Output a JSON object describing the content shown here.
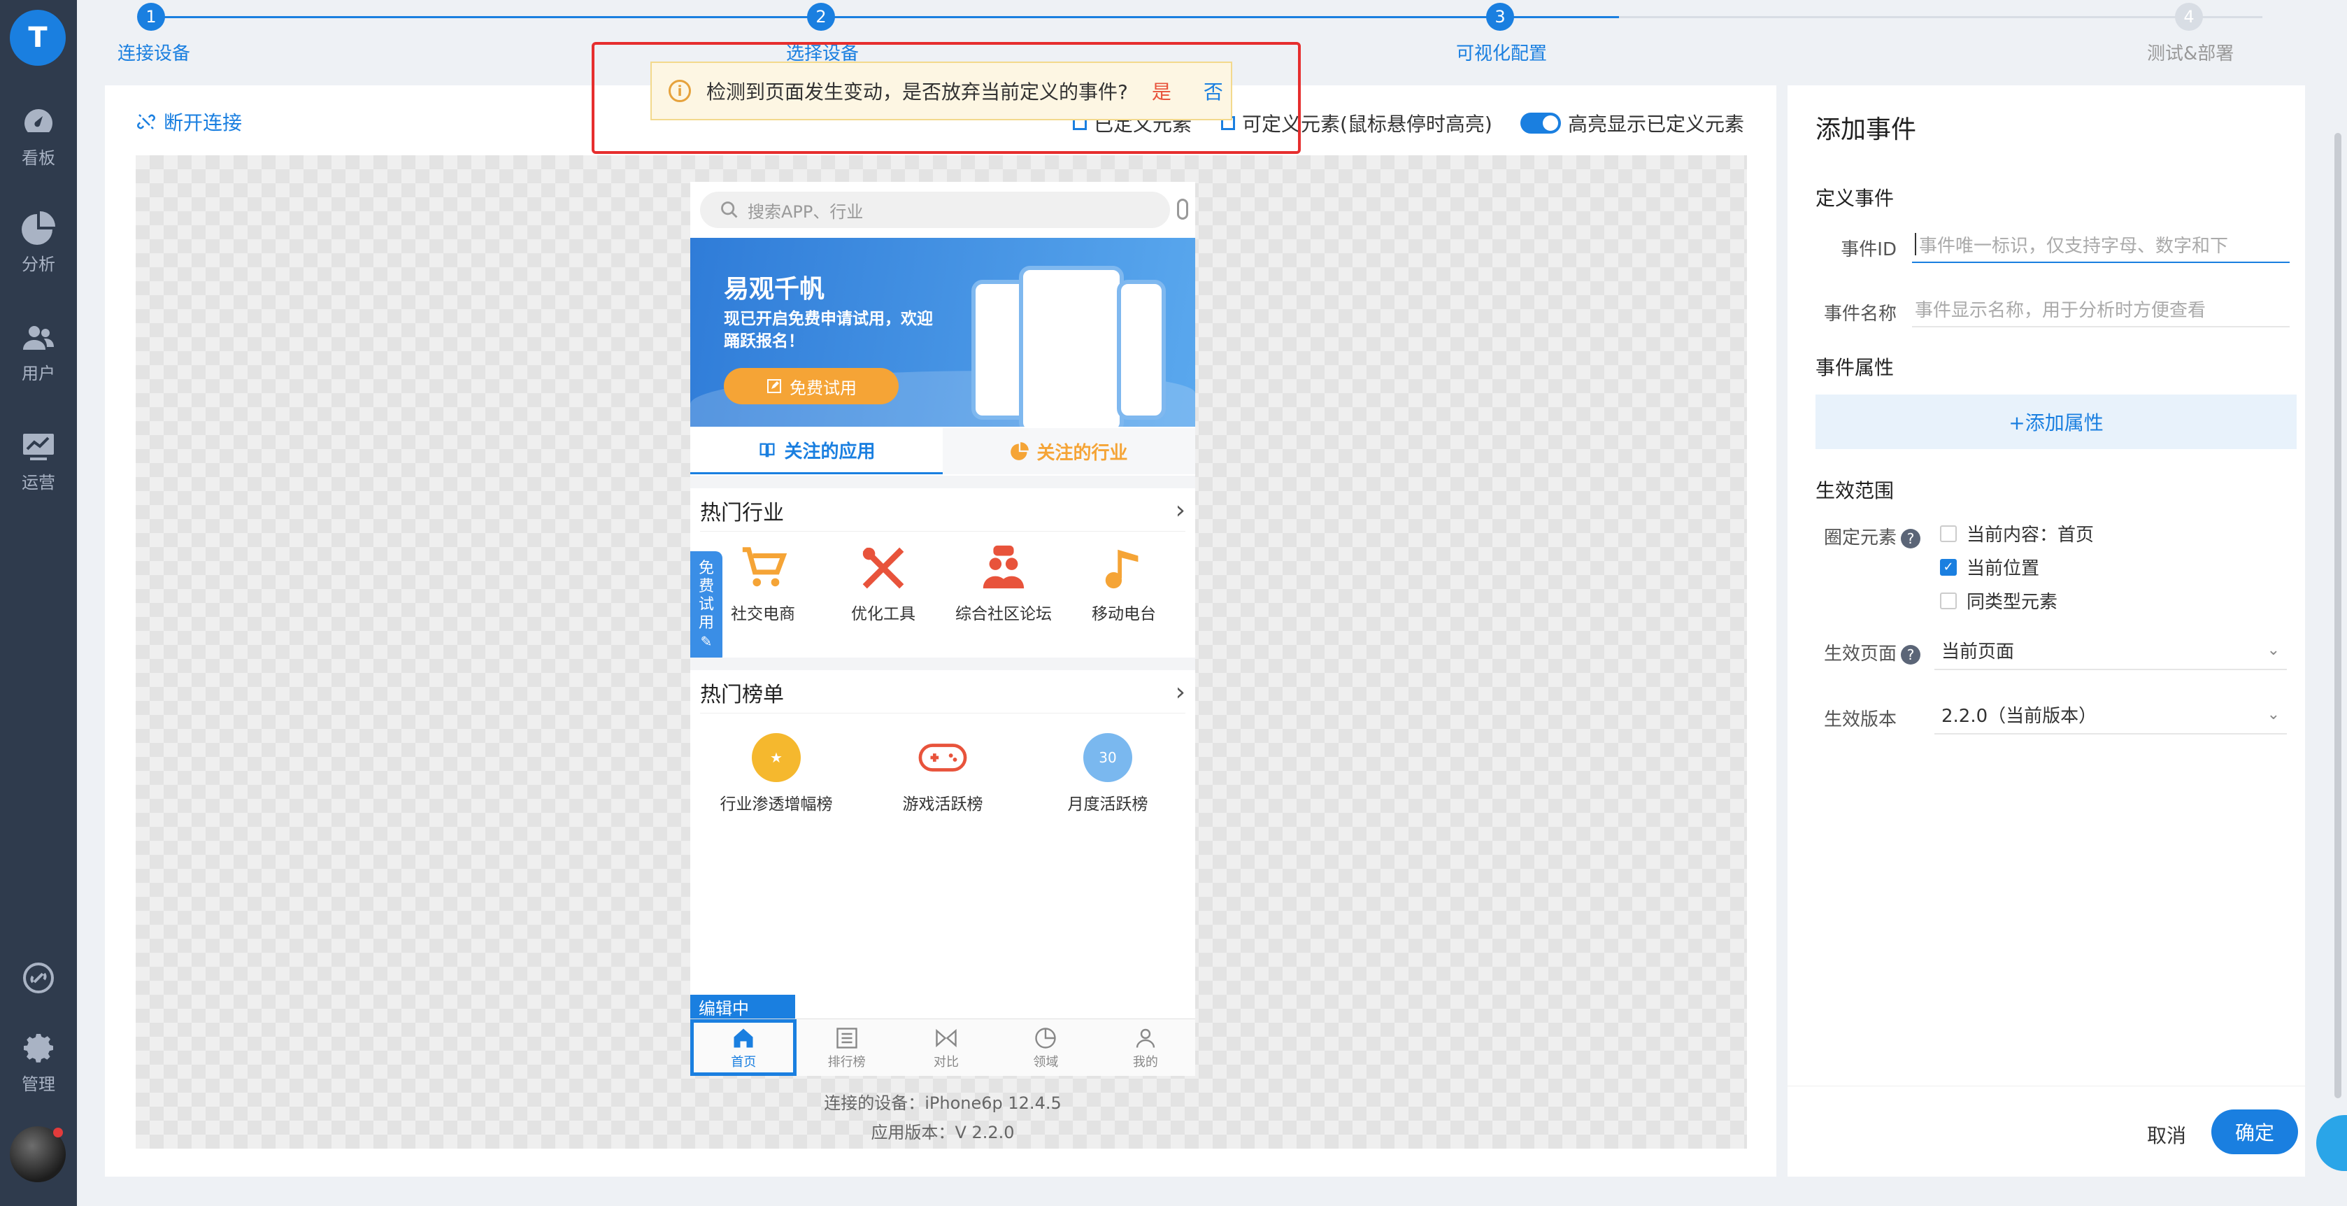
{
  "app": {
    "logo_letter": "T"
  },
  "sidebar": {
    "items": [
      {
        "label": "看板",
        "icon": "dashboard-icon"
      },
      {
        "label": "分析",
        "icon": "pie-chart-icon"
      },
      {
        "label": "用户",
        "icon": "users-icon"
      },
      {
        "label": "运营",
        "icon": "monitor-icon"
      },
      {
        "label": "",
        "icon": "link-icon"
      },
      {
        "label": "管理",
        "icon": "gear-icon"
      }
    ]
  },
  "stepper": {
    "steps": [
      {
        "number": "1",
        "label": "连接设备",
        "state": "done"
      },
      {
        "number": "2",
        "label": "选择设备",
        "state": "done"
      },
      {
        "number": "3",
        "label": "可视化配置",
        "state": "active"
      },
      {
        "number": "4",
        "label": "测试&部署",
        "state": "pending"
      }
    ]
  },
  "toolbar": {
    "disconnect": "断开连接",
    "legend_defined": "已定义元素",
    "legend_definable": "可定义元素(鼠标悬停时高亮)",
    "highlight_toggle": "高亮显示已定义元素"
  },
  "toast": {
    "message": "检测到页面发生变动，是否放弃当前定义的事件?",
    "yes": "是",
    "no": "否"
  },
  "phone": {
    "search_placeholder": "搜索APP、行业",
    "banner": {
      "title": "易观千帆",
      "subtitle": "现已开启免费申请试用，欢迎踊跃报名！",
      "button": "免费试用"
    },
    "tabs": [
      "关注的应用",
      "关注的行业"
    ],
    "hot_industry": {
      "title": "热门行业",
      "items": [
        "社交电商",
        "优化工具",
        "综合社区论坛",
        "移动电台"
      ]
    },
    "side_tag": [
      "免",
      "费",
      "试",
      "用"
    ],
    "hot_rank": {
      "title": "热门榜单",
      "items": [
        "行业渗透增幅榜",
        "游戏活跃榜",
        "月度活跃榜"
      ],
      "calendar_day": "30"
    },
    "editing_badge": "编辑中",
    "bottom_nav": [
      "首页",
      "排行榜",
      "对比",
      "领域",
      "我的"
    ],
    "device_label": "连接的设备：",
    "device_value": "iPhone6p 12.4.5",
    "version_label": "应用版本：",
    "version_value": "V 2.2.0"
  },
  "panel": {
    "title": "添加事件",
    "define_event": "定义事件",
    "event_id_label": "事件ID",
    "event_id_placeholder": "事件唯一标识，仅支持字母、数字和下",
    "event_name_label": "事件名称",
    "event_name_placeholder": "事件显示名称，用于分析时方便查看",
    "event_attr": "事件属性",
    "add_attr": "+添加属性",
    "scope": "生效范围",
    "circle_label": "圈定元素",
    "checks": [
      {
        "label": "当前内容：首页",
        "checked": false
      },
      {
        "label": "当前位置",
        "checked": true
      },
      {
        "label": "同类型元素",
        "checked": false
      }
    ],
    "page_label": "生效页面",
    "page_value": "当前页面",
    "version_label": "生效版本",
    "version_value": "2.2.0（当前版本）",
    "cancel": "取消",
    "confirm": "确定"
  },
  "colors": {
    "primary": "#1a7fe0",
    "sidebar": "#2f3b4d",
    "warning_border": "#e62e2e",
    "toast_bg": "#fdf6e3",
    "accent_orange": "#f5a436"
  }
}
